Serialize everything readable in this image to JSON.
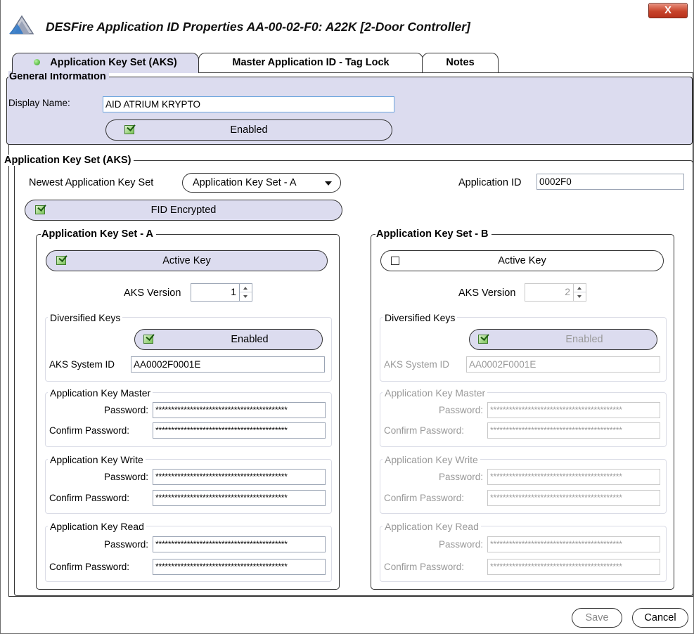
{
  "window": {
    "title": "DESFire Application ID Properties  AA-00-02-F0: A22K [2-Door Controller]",
    "close_label": "X"
  },
  "tabs": [
    {
      "label": "Application Key Set (AKS)",
      "active": true,
      "status": "green"
    },
    {
      "label": "Master Application ID - Tag Lock",
      "active": false
    },
    {
      "label": "Notes",
      "active": false
    }
  ],
  "general": {
    "title": "General Information",
    "display_name_label": "Display Name:",
    "display_name_value": "AID ATRIUM KRYPTO",
    "enabled_label": "Enabled",
    "enabled_checked": true
  },
  "aks": {
    "title": "Application Key Set (AKS)",
    "newest_label": "Newest Application Key Set",
    "newest_value": "Application Key Set - A",
    "app_id_label": "Application ID",
    "app_id_value": "0002F0",
    "fid_label": "FID Encrypted",
    "fid_checked": true
  },
  "set_a": {
    "title": "Application Key Set - A",
    "active_label": "Active Key",
    "active_checked": true,
    "version_label": "AKS Version",
    "version_value": "1",
    "diversified_title": "Diversified Keys",
    "diversified_enabled_label": "Enabled",
    "diversified_checked": true,
    "system_id_label": "AKS System ID",
    "system_id_value": "AA0002F0001E",
    "master_title": "Application Key Master",
    "write_title": "Application Key Write",
    "read_title": "Application Key Read",
    "password_label": "Password:",
    "confirm_label": "Confirm Password:",
    "password_mask": "******************************************"
  },
  "set_b": {
    "title": "Application Key Set - B",
    "active_label": "Active Key",
    "active_checked": false,
    "version_label": "AKS Version",
    "version_value": "2",
    "diversified_title": "Diversified Keys",
    "diversified_enabled_label": "Enabled",
    "diversified_checked": true,
    "system_id_label": "AKS System ID",
    "system_id_value": "AA0002F0001E",
    "master_title": "Application Key Master",
    "write_title": "Application Key Write",
    "read_title": "Application Key Read",
    "password_label": "Password:",
    "confirm_label": "Confirm Password:",
    "password_mask": "******************************************"
  },
  "footer": {
    "save_label": "Save",
    "cancel_label": "Cancel"
  }
}
